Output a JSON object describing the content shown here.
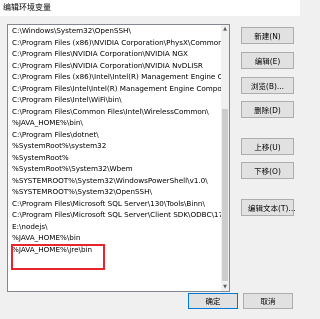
{
  "window": {
    "title": "编辑环境变量"
  },
  "path_list": {
    "entries": [
      "C:\\Windows\\System32\\OpenSSH\\",
      "C:\\Program Files (x86)\\NVIDIA Corporation\\PhysX\\Common",
      "C:\\Program Files\\NVIDIA Corporation\\NVIDIA NGX",
      "C:\\Program Files\\NVIDIA Corporation\\NVIDIA NvDLISR",
      "C:\\Program Files (x86)\\Intel\\Intel(R) Management Engine Co...",
      "C:\\Program Files\\Intel\\Intel(R) Management Engine Compone...",
      "C:\\Program Files\\Intel\\WiFi\\bin\\",
      "C:\\Program Files\\Common Files\\Intel\\WirelessCommon\\",
      "%JAVA_HOME%\\bin\\",
      "C:\\Program Files\\dotnet\\",
      "%SystemRoot%\\system32",
      "%SystemRoot%",
      "%SystemRoot%\\System32\\Wbem",
      "%SYSTEMROOT%\\System32\\WindowsPowerShell\\v1.0\\",
      "%SYSTEMROOT%\\System32\\OpenSSH\\",
      "C:\\Program Files\\Microsoft SQL Server\\130\\Tools\\Binn\\",
      "C:\\Program Files\\Microsoft SQL Server\\Client SDK\\ODBC\\17...",
      "E:\\nodejs\\",
      "%JAVA_HOME%\\bin",
      "%JAVA_HOME%\\jre\\bin",
      "",
      "",
      ""
    ]
  },
  "buttons": {
    "new": "新建(N)",
    "edit": "编辑(E)",
    "browse": "浏览(B)...",
    "delete": "删除(D)",
    "move_up": "上移(U)",
    "move_down": "下移(O)",
    "edit_text": "编辑文本(T)...",
    "ok": "确定",
    "cancel": "取消"
  },
  "colors": {
    "highlight_box": "#e8242c",
    "default_button_border": "#0078d7"
  }
}
